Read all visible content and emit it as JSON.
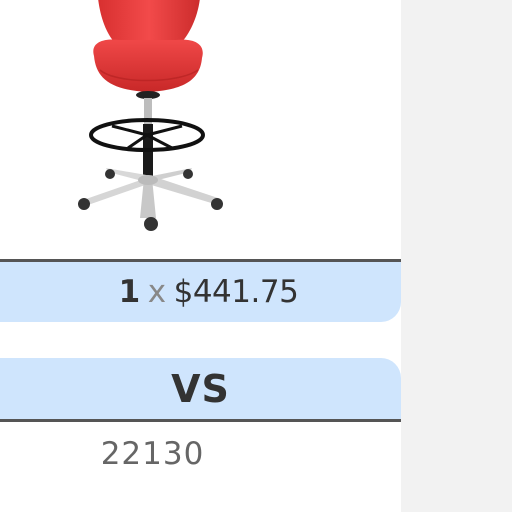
{
  "product": {
    "image_icon": "red-drafting-chair-image"
  },
  "price_bar": {
    "quantity": "1",
    "times": "x",
    "price": "$441.75"
  },
  "vs_bar": {
    "label": "VS"
  },
  "code": {
    "value": "22130"
  },
  "colors": {
    "page_background": "#f2f2f2",
    "panel_background": "#ffffff",
    "bar_background": "#cfe5fd",
    "bar_border": "#555555",
    "chair_seat": "#e63a3a"
  }
}
